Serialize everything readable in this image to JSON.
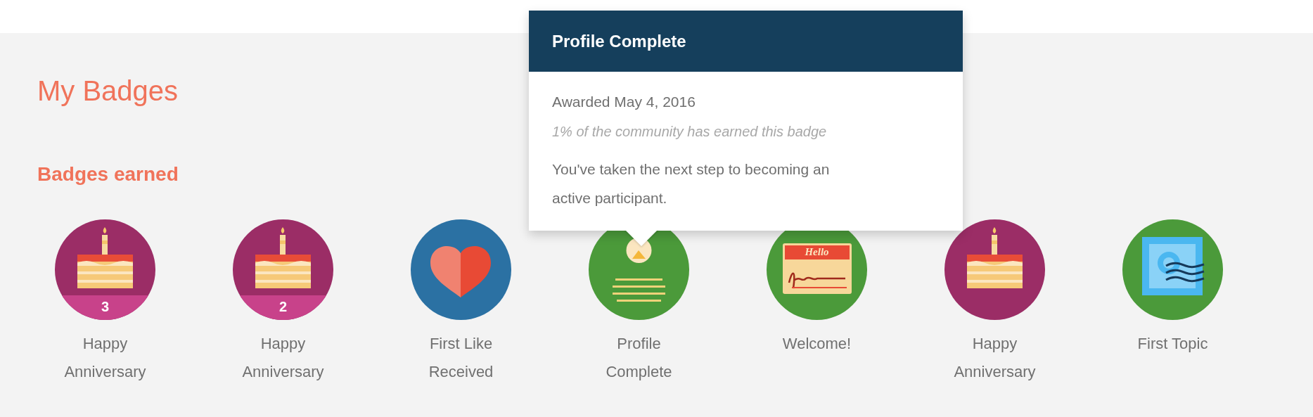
{
  "page": {
    "title": "My Badges"
  },
  "section": {
    "title": "Badges earned"
  },
  "badges": [
    {
      "kind": "cake",
      "label": "Happy Anniversary",
      "count": "3"
    },
    {
      "kind": "cake",
      "label": "Happy Anniversary",
      "count": "2"
    },
    {
      "kind": "heart",
      "label": "First Like Received"
    },
    {
      "kind": "profile",
      "label": "Profile Complete"
    },
    {
      "kind": "hello",
      "label": "Welcome!",
      "sticker_text": "Hello"
    },
    {
      "kind": "cake",
      "label": "Happy Anniversary"
    },
    {
      "kind": "stamp",
      "label": "First Topic"
    }
  ],
  "tooltip": {
    "title": "Profile Complete",
    "awarded": "Awarded May 4, 2016",
    "share": "1% of the community has earned this badge",
    "description": "You've taken the next step to becoming an active participant."
  }
}
